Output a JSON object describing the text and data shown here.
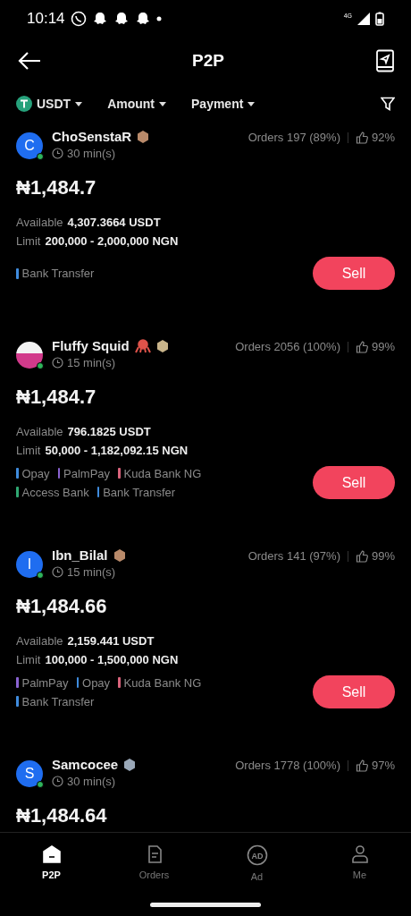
{
  "status_bar": {
    "time": "10:14",
    "network": "4G"
  },
  "header": {
    "title": "P2P"
  },
  "filters": [
    {
      "kind": "coin",
      "label": "USDT"
    },
    {
      "kind": "plain",
      "label": "Amount"
    },
    {
      "kind": "plain",
      "label": "Payment"
    }
  ],
  "offers": [
    {
      "avatar": {
        "kind": "letter",
        "letter": "C"
      },
      "name": "ChoSenstaR",
      "octopus": false,
      "color": "#b98a6a",
      "online": true,
      "time": "30 min(s)",
      "orders": "Orders 197 (89%)",
      "rating": "92%",
      "price": "₦1,484.7",
      "available_label": "Available",
      "available": "4,307.3664 USDT",
      "limit_label": "Limit",
      "limit": "200,000 - 2,000,000 NGN",
      "payments": [
        {
          "label": "Bank Transfer",
          "color": "#3f8cde"
        }
      ],
      "action": "Sell"
    },
    {
      "avatar": {
        "kind": "photo"
      },
      "name": "Fluffy Squid",
      "octopus": true,
      "color": "#c9b48a",
      "online": true,
      "time": "15 min(s)",
      "orders": "Orders 2056 (100%)",
      "rating": "99%",
      "price": "₦1,484.7",
      "available_label": "Available",
      "available": "796.1825 USDT",
      "limit_label": "Limit",
      "limit": "50,000 - 1,182,092.15 NGN",
      "payments": [
        {
          "label": "Opay",
          "color": "#3f8cde"
        },
        {
          "label": "PalmPay",
          "color": "#8a63d2"
        },
        {
          "label": "Kuda Bank NG",
          "color": "#d9637b"
        },
        {
          "label": "Access Bank",
          "color": "#2fa872"
        },
        {
          "label": "Bank Transfer",
          "color": "#3f8cde"
        }
      ],
      "action": "Sell"
    },
    {
      "avatar": {
        "kind": "letter",
        "letter": "I"
      },
      "name": "Ibn_Bilal",
      "octopus": false,
      "color": "#b98a6a",
      "online": true,
      "time": "15 min(s)",
      "orders": "Orders 141 (97%)",
      "rating": "99%",
      "price": "₦1,484.66",
      "available_label": "Available",
      "available": "2,159.441 USDT",
      "limit_label": "Limit",
      "limit": "100,000 - 1,500,000 NGN",
      "payments": [
        {
          "label": "PalmPay",
          "color": "#8a63d2"
        },
        {
          "label": "Opay",
          "color": "#3f8cde"
        },
        {
          "label": "Kuda Bank NG",
          "color": "#d9637b"
        },
        {
          "label": "Bank Transfer",
          "color": "#3f8cde"
        }
      ],
      "action": "Sell"
    },
    {
      "avatar": {
        "kind": "letter",
        "letter": "S"
      },
      "name": "Samcocee",
      "octopus": false,
      "color": "#9aa8b8",
      "online": true,
      "time": "30 min(s)",
      "orders": "Orders 1778 (100%)",
      "rating": "97%",
      "price": "₦1,484.64"
    }
  ],
  "nav": [
    {
      "kind": "p2p",
      "label": "P2P",
      "selected": true
    },
    {
      "kind": "orders",
      "label": "Orders",
      "selected": false
    },
    {
      "kind": "ad",
      "icon_text": "AD",
      "label": "Ad",
      "selected": false
    },
    {
      "kind": "me",
      "label": "Me",
      "selected": false
    }
  ]
}
